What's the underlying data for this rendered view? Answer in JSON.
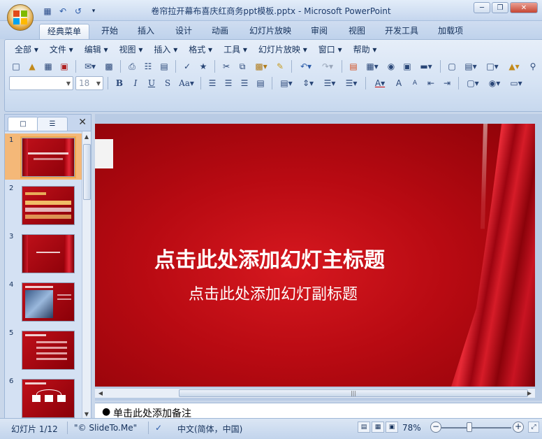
{
  "window": {
    "title": "卷帘拉开幕布喜庆红商务ppt模板.pptx - Microsoft PowerPoint",
    "minimize": "─",
    "restore": "❐",
    "close": "✕"
  },
  "quick_access": {
    "save_icon": "save-icon",
    "undo_icon": "undo-icon",
    "redo_icon": "redo-icon",
    "customize_icon": "customize-icon"
  },
  "tabs": [
    "经典菜单",
    "开始",
    "插入",
    "设计",
    "动画",
    "幻灯片放映",
    "审阅",
    "视图",
    "开发工具",
    "加载项"
  ],
  "active_tab_index": 0,
  "menu": [
    "全部 ▾",
    "文件 ▾",
    "编辑 ▾",
    "视图 ▾",
    "插入 ▾",
    "格式 ▾",
    "工具 ▾",
    "幻灯片放映 ▾",
    "窗口 ▾",
    "帮助 ▾"
  ],
  "format": {
    "font_value": "",
    "size_value": "18"
  },
  "slides": [
    {
      "num": "1",
      "selected": true
    },
    {
      "num": "2",
      "selected": false
    },
    {
      "num": "3",
      "selected": false
    },
    {
      "num": "4",
      "selected": false
    },
    {
      "num": "5",
      "selected": false
    },
    {
      "num": "6",
      "selected": false
    }
  ],
  "slide": {
    "title": "点击此处添加幻灯主标题",
    "subtitle": "点击此处添加幻灯副标题"
  },
  "notes": {
    "bullet": "●",
    "text": "单击此处添加备注"
  },
  "status": {
    "slide_count": "幻灯片 1/12",
    "theme": "\"© SlideTo.Me\"",
    "language": "中文(简体，中国)",
    "zoom": "78%",
    "zoom_level": 0.78
  },
  "colors": {
    "slide_red": "#b80a12",
    "accent": "#f2a64a"
  }
}
